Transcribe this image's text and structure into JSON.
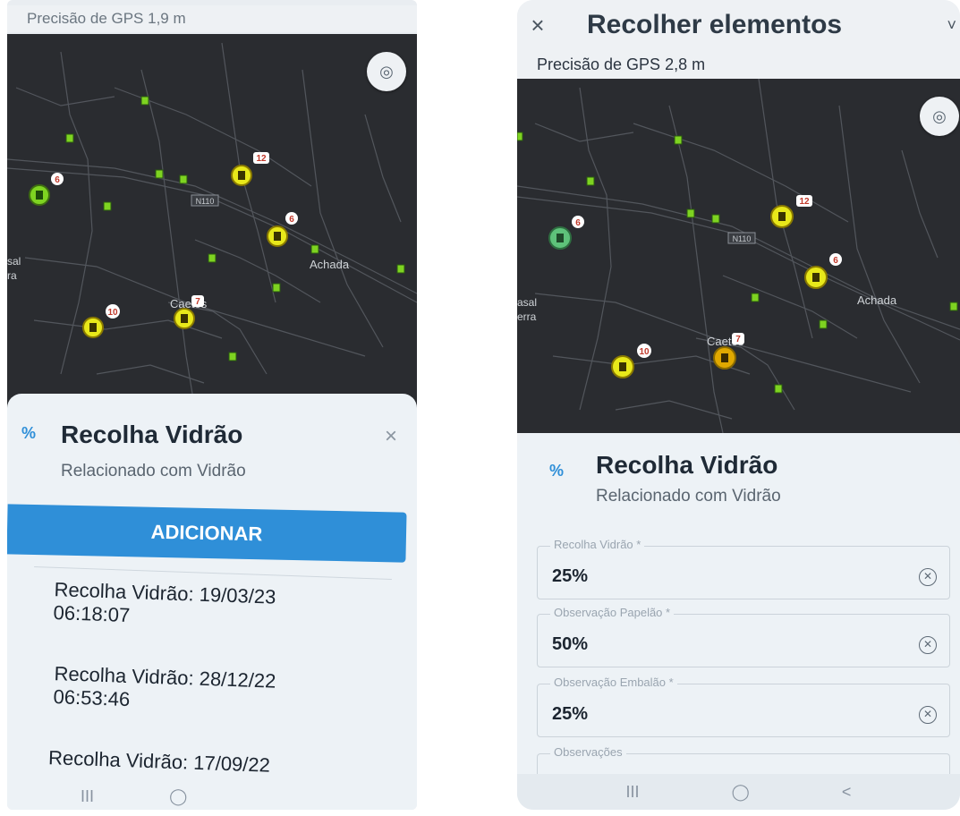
{
  "left_screen": {
    "gps_precision": "Precisão de GPS 1,9 m",
    "map": {
      "road_label": "N110",
      "place_labels": [
        "Achada",
        "Caetos",
        "sal",
        "ra"
      ],
      "cluster_counts": [
        "6",
        "12",
        "6",
        "7",
        "10"
      ]
    },
    "sheet": {
      "title": "Recolha Vidrão",
      "subtitle": "Relacionado com Vidrão",
      "close_icon": "close-icon",
      "add_button": "ADICIONAR",
      "records": [
        {
          "label": "Recolha Vidrão: 19/03/23",
          "time": "06:18:07"
        },
        {
          "label": "Recolha Vidrão: 28/12/22",
          "time": "06:53:46"
        },
        {
          "label": "Recolha Vidrão: 17/09/22",
          "time": ""
        }
      ]
    },
    "nav": {
      "recents": "III",
      "home": "◯",
      "back": "<"
    }
  },
  "right_screen": {
    "header": {
      "close": "×",
      "title": "Recolher elementos",
      "caret": "˅"
    },
    "gps_precision": "Precisão de GPS 2,8 m",
    "map": {
      "road_label": "N110",
      "place_labels": [
        "Achada",
        "Caetos",
        "asal",
        "erra"
      ],
      "cluster_counts": [
        "6",
        "12",
        "6",
        "7",
        "10"
      ]
    },
    "sheet": {
      "title": "Recolha Vidrão",
      "subtitle": "Relacionado com Vidrão",
      "fields": [
        {
          "label": "Recolha Vidrão *",
          "value": "25%"
        },
        {
          "label": "Observação Papelão *",
          "value": "50%"
        },
        {
          "label": "Observação Embalão *",
          "value": "25%"
        },
        {
          "label": "Observações",
          "value": ""
        }
      ]
    },
    "nav": {
      "recents": "III",
      "home": "◯",
      "back": "<"
    }
  },
  "colors": {
    "accent": "#2f8fd8",
    "map_background": "#2a2c30",
    "marker_yellow": "#e8e81a",
    "marker_green": "#7ed321",
    "sheet_background": "#edf2f6"
  }
}
